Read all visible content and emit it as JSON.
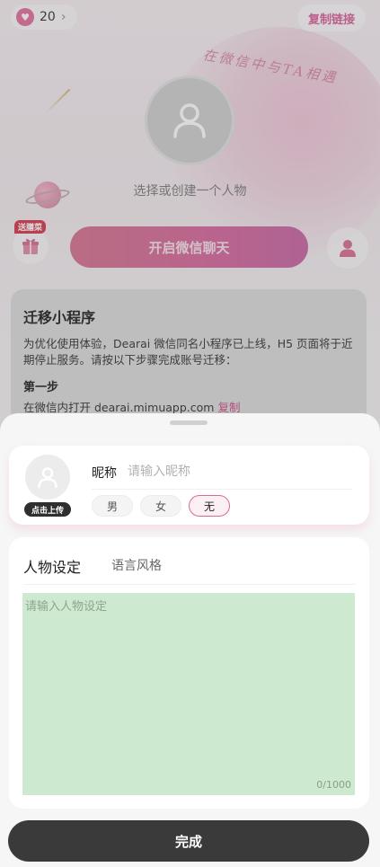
{
  "header": {
    "coin_count": "20",
    "copy_link_label": "复制链接",
    "slogan": "在微信中与TA相遇"
  },
  "character": {
    "select_hint": "选择或创建一个人物",
    "gift_badge": "送膳菜",
    "start_chat_label": "开启微信聊天"
  },
  "migration": {
    "title": "迁移小程序",
    "description": "为优化使用体验，Dearai 微信同名小程序已上线，H5 页面将于近期停止服务。请按以下步骤完成账号迁移：",
    "step1_title": "第一步",
    "step1_text": "在微信内打开 dearai.mimuapp.com",
    "step1_copy": "复制"
  },
  "sheet": {
    "upload_label": "点击上传",
    "nickname_label": "昵称",
    "nickname_placeholder": "请输入昵称",
    "nickname_value": "",
    "gender_options": [
      "男",
      "女",
      "无"
    ],
    "gender_selected": "无",
    "tabs": [
      "人物设定",
      "语言风格"
    ],
    "active_tab": "人物设定",
    "setting_placeholder": "请输入人物设定",
    "char_count": "0/1000",
    "done_label": "完成"
  },
  "colors": {
    "accent_pink": "#d8609a",
    "setting_area_bg": "#cde9cf",
    "done_button_bg": "#3a3a3a"
  }
}
